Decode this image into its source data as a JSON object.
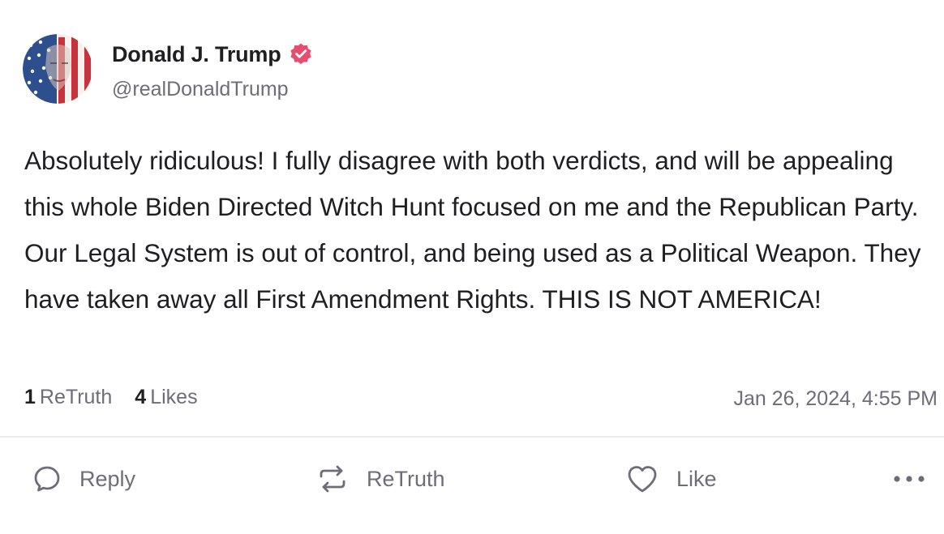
{
  "author": {
    "display_name": "Donald J. Trump",
    "handle": "@realDonaldTrump",
    "verified_icon": "verified-badge-icon",
    "avatar_icon": "avatar"
  },
  "post": {
    "text": "Absolutely ridiculous! I fully disagree with both verdicts, and will be appealing this whole Biden Directed Witch Hunt focused on me and the Republican Party. Our Legal System is out of control, and being used as a Political Weapon. They have taken away all First Amendment Rights. THIS IS NOT AMERICA!",
    "retruth_count": "1",
    "retruth_label": "ReTruth",
    "likes_count": "4",
    "likes_label": "Likes",
    "timestamp": "Jan 26, 2024, 4:55 PM"
  },
  "actions": {
    "reply_label": "Reply",
    "retruth_label": "ReTruth",
    "like_label": "Like",
    "more_icon": "more-horizontal-icon"
  },
  "colors": {
    "text_primary": "#1f1e22",
    "text_secondary": "#6f6c79",
    "verified": "#e84d6f",
    "divider": "#ebeaee"
  }
}
